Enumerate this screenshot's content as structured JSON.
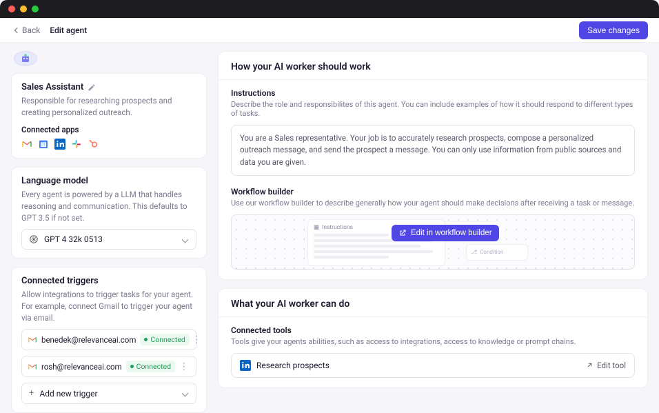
{
  "topbar": {
    "back_label": "Back",
    "breadcrumb_current": "Edit agent",
    "save_label": "Save changes"
  },
  "agent": {
    "name": "Sales Assistant",
    "description": "Responsible for researching prospects and creating personalized outreach.",
    "connected_apps_heading": "Connected apps",
    "apps": [
      "gmail",
      "google-calendar",
      "linkedin",
      "slack",
      "hubspot"
    ]
  },
  "llm": {
    "heading": "Language model",
    "helper": "Every agent is powered by a LLM that handles reasoning and communication. This defaults to GPT 3.5 if not set.",
    "selected": "GPT 4 32k 0513"
  },
  "triggers": {
    "heading": "Connected triggers",
    "helper": "Allow integrations to trigger tasks for your agent. For example, connect Gmail to trigger your agent via email.",
    "items": [
      {
        "email": "benedek@relevanceai.com",
        "status": "Connected"
      },
      {
        "email": "rosh@relevanceai.com",
        "status": "Connected"
      }
    ],
    "add_label": "Add new trigger"
  },
  "work": {
    "heading": "How your AI worker should work",
    "instructions_heading": "Instructions",
    "instructions_helper": "Describe the role and responsibilites of this agent. You can include examples of how it should respond to different types of tasks.",
    "instructions_value": "You are a Sales representative. Your job is to accurately research prospects, compose a personalized outreach message, and send the prospect a message. You can only use information from public sources and data you are given.",
    "wf_heading": "Workflow builder",
    "wf_helper": "Use our workflow builder to describe generally how your agent should make decisions after receiving a task or message.",
    "wf_edit_label": "Edit in workflow builder",
    "wf_preview_instructions_label": "Instructions",
    "wf_preview_condition_label": "Condition"
  },
  "cando": {
    "heading": "What your AI worker can do",
    "tools_heading": "Connected tools",
    "tools_helper": "Tools give your agents abilities, such as access to integrations, access to knowledge or prompt chains.",
    "tools": [
      {
        "name": "Research prospects",
        "icon": "linkedin"
      }
    ],
    "edit_tool_label": "Edit tool"
  }
}
